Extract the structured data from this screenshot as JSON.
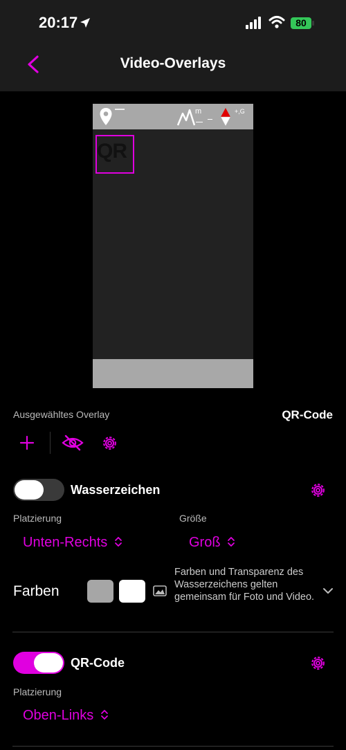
{
  "status": {
    "time": "20:17",
    "battery": "80"
  },
  "nav": {
    "title": "Video-Overlays"
  },
  "preview": {
    "qr_label": "QR"
  },
  "selected": {
    "label": "Ausgewähltes Overlay",
    "value": "QR-Code"
  },
  "watermark": {
    "toggle_label": "Wasserzeichen",
    "enabled": true,
    "placement_label": "Platzierung",
    "placement_value": "Unten-Rechts",
    "size_label": "Größe",
    "size_value": "Groß",
    "colors_label": "Farben",
    "colors_description": "Farben und Transparenz des Wasserzeichens gelten gemeinsam für Foto und Video.",
    "swatches": [
      "#a6a6a6",
      "#ffffff"
    ]
  },
  "qr": {
    "toggle_label": "QR-Code",
    "enabled": true,
    "placement_label": "Platzierung",
    "placement_value": "Oben-Links"
  },
  "colors": {
    "accent": "#e000e0",
    "toggle_off": "#3a3a3a"
  }
}
